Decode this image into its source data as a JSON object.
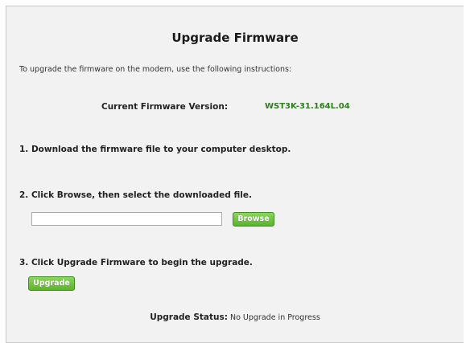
{
  "page": {
    "title": "Upgrade Firmware",
    "intro": "To upgrade the firmware on the modem, use the following instructions:"
  },
  "firmware": {
    "label": "Current Firmware Version:",
    "version": "WST3K-31.164L.04"
  },
  "steps": [
    {
      "text": "1. Download the firmware file to your computer desktop."
    },
    {
      "text": "2. Click Browse, then select the downloaded file."
    },
    {
      "text": "3. Click Upgrade Firmware to begin the upgrade."
    }
  ],
  "file_input": {
    "value": "",
    "placeholder": ""
  },
  "buttons": {
    "browse_label": "Browse",
    "upgrade_label": "Upgrade"
  },
  "status": {
    "label": "Upgrade Status:",
    "value": "No Upgrade in Progress"
  },
  "colors": {
    "accent_green": "#5cb32e",
    "version_green": "#2e7d1f",
    "panel_background": "#f2f2f2"
  }
}
